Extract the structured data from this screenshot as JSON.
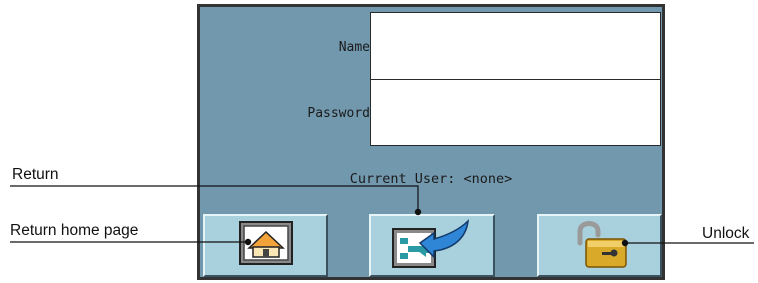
{
  "form": {
    "name_label": "Name",
    "name_value": "",
    "password_label": "Password",
    "password_value": "",
    "current_user": "Current User: <none>"
  },
  "buttons": [
    {
      "id": "home",
      "icon": "home-icon"
    },
    {
      "id": "return",
      "icon": "return-arrow-icon"
    },
    {
      "id": "unlock",
      "icon": "unlocked-padlock-icon"
    }
  ],
  "callouts": {
    "return": "Return",
    "return_home": "Return home page",
    "unlock": "Unlock"
  },
  "colors": {
    "screen_bg": "#7298ae",
    "button_bg": "#a9d1dd",
    "padlock": "#d9a92a"
  }
}
